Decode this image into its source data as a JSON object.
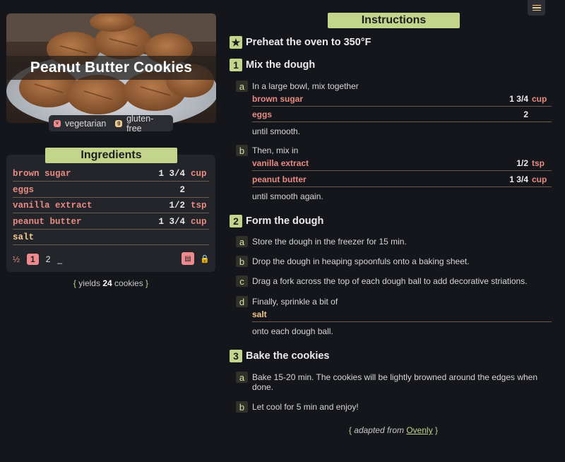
{
  "recipe": {
    "title": "Peanut Butter Cookies",
    "tags": [
      {
        "icon": "vegetarian-icon",
        "label": "vegetarian",
        "color": "#ef8b8f"
      },
      {
        "icon": "gluten-free-icon",
        "label": "gluten-free",
        "color": "#f1c98a"
      }
    ]
  },
  "ingredients": {
    "header": "Ingredients",
    "items": [
      {
        "name": "brown sugar",
        "qty": "1 3/4",
        "unit": "cup"
      },
      {
        "name": "eggs",
        "qty": "2",
        "unit": ""
      },
      {
        "name": "vanilla extract",
        "qty": "1/2",
        "unit": "tsp"
      },
      {
        "name": "peanut butter",
        "qty": "1 3/4",
        "unit": "cup"
      },
      {
        "name": "salt",
        "qty": "",
        "unit": ""
      }
    ],
    "scale_options": [
      "½",
      "1",
      "2",
      "_"
    ],
    "scale_selected": "1",
    "yields_prefix": "yields",
    "yields_count": "24",
    "yields_suffix": "cookies",
    "colors": {
      "accent": "#c3d58a",
      "meat": "#e98b83",
      "plain": "#f1c98a",
      "selected": "#ef8b8f"
    }
  },
  "instructions": {
    "header": "Instructions",
    "preheat": "Preheat the oven to 350°F",
    "steps": [
      {
        "num": "1",
        "title": "Mix the dough",
        "subs": [
          {
            "letter": "a",
            "text": "In a large bowl, mix together",
            "items": [
              {
                "name": "brown sugar",
                "qty": "1 3/4",
                "unit": "cup"
              },
              {
                "name": "eggs",
                "qty": "2",
                "unit": ""
              }
            ],
            "after": "until smooth."
          },
          {
            "letter": "b",
            "text": "Then, mix in",
            "items": [
              {
                "name": "vanilla extract",
                "qty": "1/2",
                "unit": "tsp"
              },
              {
                "name": "peanut butter",
                "qty": "1 3/4",
                "unit": "cup"
              }
            ],
            "after": "until smooth again."
          }
        ]
      },
      {
        "num": "2",
        "title": "Form the dough",
        "subs": [
          {
            "letter": "a",
            "text": "Store the dough in the freezer for 15 min."
          },
          {
            "letter": "b",
            "text": "Drop the dough in heaping spoonfuls onto a baking sheet."
          },
          {
            "letter": "c",
            "text": "Drag a fork across the top of each dough ball to add decorative striations."
          },
          {
            "letter": "d",
            "text": "Finally, sprinkle a bit of",
            "items": [
              {
                "name": "salt",
                "qty": "",
                "unit": ""
              }
            ],
            "after": "onto each dough ball."
          }
        ]
      },
      {
        "num": "3",
        "title": "Bake the cookies",
        "subs": [
          {
            "letter": "a",
            "text": "Bake 15-20 min. The cookies will be lightly browned around the edges when done."
          },
          {
            "letter": "b",
            "text": "Let cool for 5 min and enjoy!"
          }
        ]
      }
    ],
    "credit_prefix": "adapted from",
    "credit_link": "Ovenly"
  }
}
